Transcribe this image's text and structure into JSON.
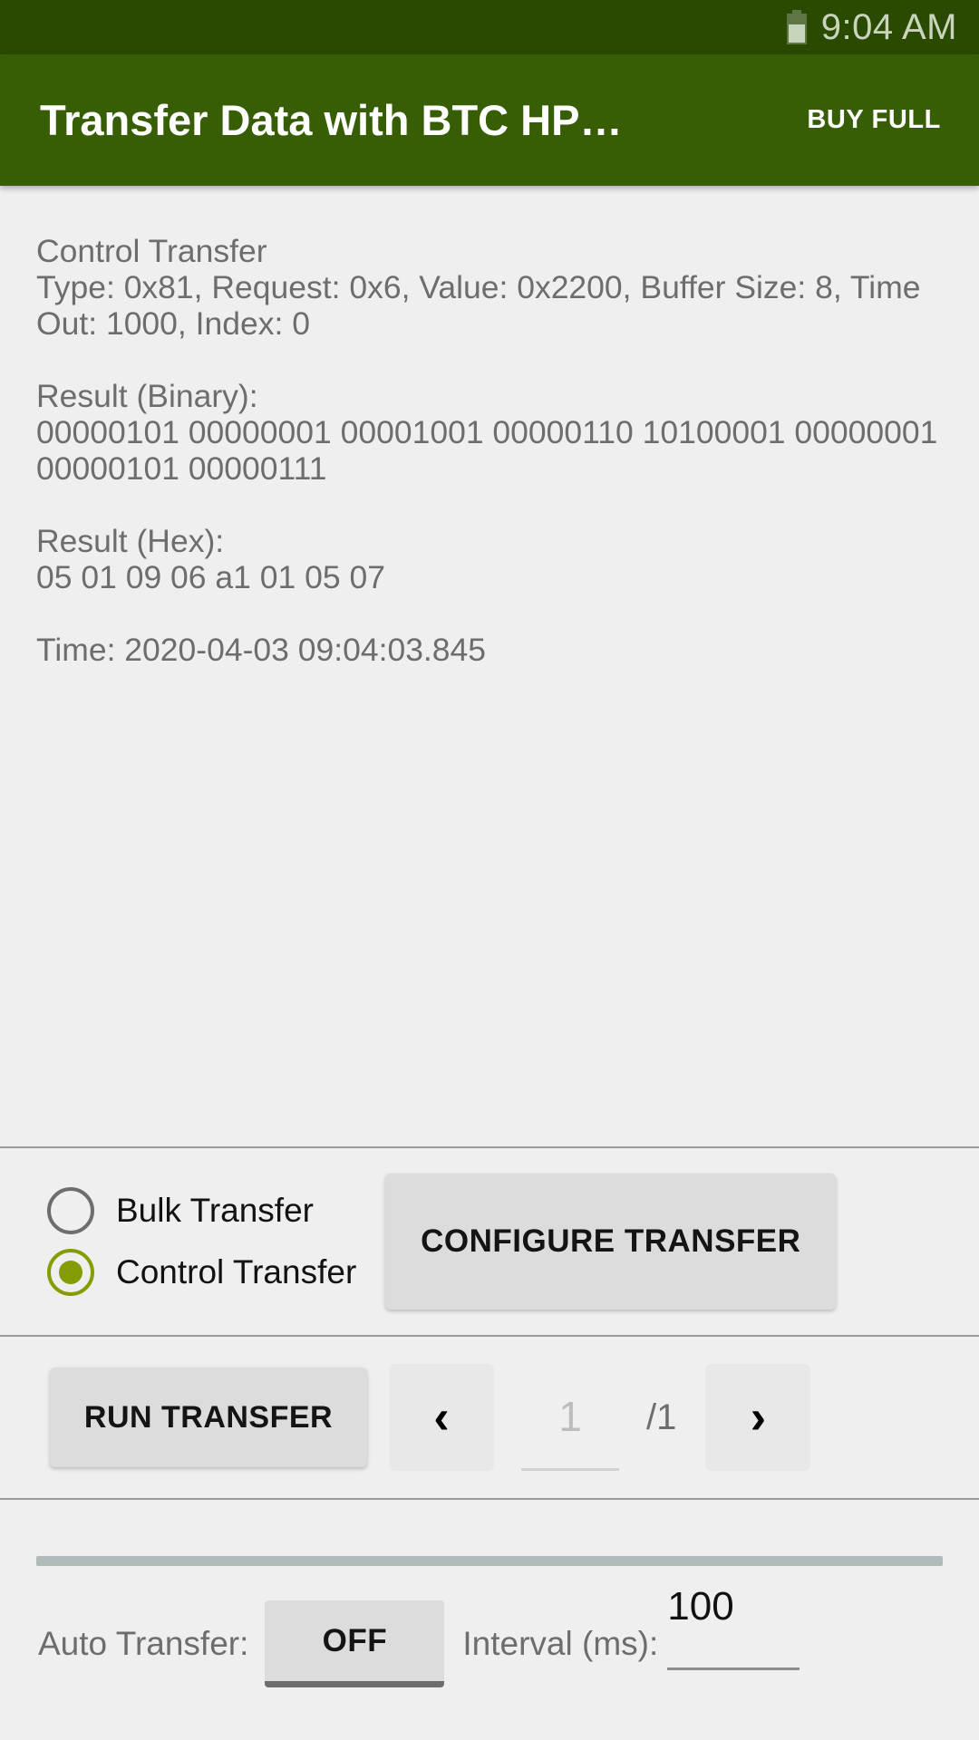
{
  "status_bar": {
    "battery_icon": "battery-icon",
    "time": "9:04 AM"
  },
  "app_bar": {
    "title": "Transfer Data with BTC HP…",
    "buy_full_label": "BUY FULL"
  },
  "log": {
    "heading": "Control Transfer",
    "params_line": "Type: 0x81, Request: 0x6, Value: 0x2200, Buffer Size: 8, Time Out: 1000, Index: 0",
    "binary_label": "Result (Binary):",
    "binary_value": "00000101 00000001 00001001 00000110 10100001 00000001 00000101 00000111",
    "hex_label": "Result (Hex):",
    "hex_value": "05 01 09 06 a1 01 05 07",
    "time_line": "Time: 2020-04-03 09:04:03.845"
  },
  "transfer_mode": {
    "options": [
      {
        "label": "Bulk Transfer",
        "selected": false
      },
      {
        "label": "Control Transfer",
        "selected": true
      }
    ],
    "configure_label": "CONFIGURE TRANSFER",
    "selected_color": "#879c04"
  },
  "run_row": {
    "run_label": "RUN TRANSFER",
    "prev_icon": "chevron-left-icon",
    "prev_glyph": "‹",
    "page_value": "1",
    "page_total": "/1",
    "next_icon": "chevron-right-icon",
    "next_glyph": "›"
  },
  "auto_row": {
    "auto_label": "Auto Transfer:",
    "auto_state": "OFF",
    "interval_label": "Interval (ms):",
    "interval_value": "100"
  },
  "colors": {
    "status_bar": "#2b4a01",
    "app_bar": "#375e04",
    "background": "#efefef",
    "log_text": "#6d6d6d",
    "accent": "#879c04"
  }
}
